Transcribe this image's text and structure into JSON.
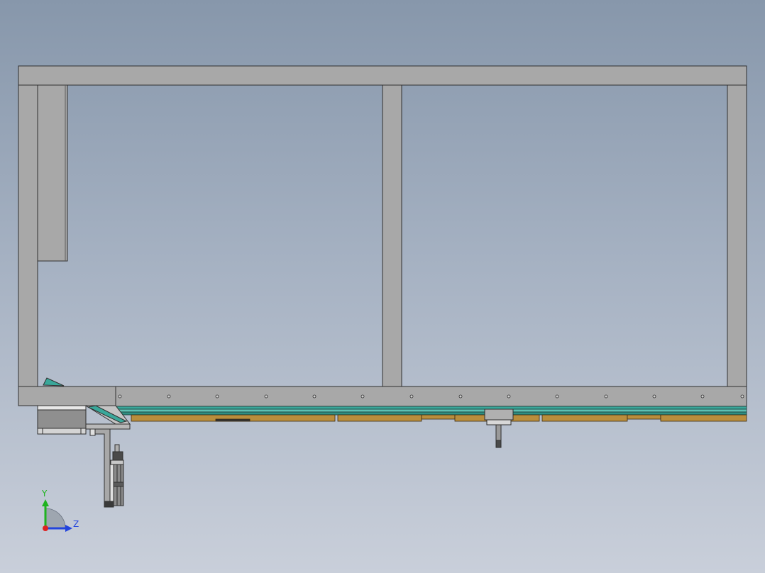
{
  "viewport": {
    "background_top": "#8797ab",
    "background_bottom": "#c9cfda"
  },
  "colors": {
    "frame_gray": "#a8a8a8",
    "edge": "#2f2f2f",
    "conveyor_teal": "#3aa79a",
    "wood": "#b98d3c",
    "dark_part": "#4a4a4a"
  },
  "triad": {
    "y_label": "Y",
    "z_label": "Z",
    "y_color": "#1fb31f",
    "z_color": "#2244dd",
    "x_color": "#dd2222"
  }
}
